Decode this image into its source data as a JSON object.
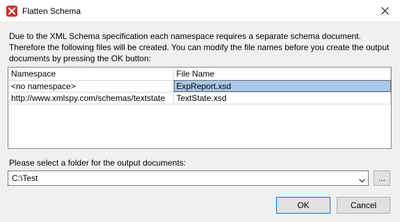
{
  "window": {
    "title": "Flatten Schema",
    "icon": "xmlspy-app-icon",
    "close_icon": "close-icon"
  },
  "description": {
    "line1": "Due to the XML Schema specification each namespace requires a separate schema document.",
    "line2": "Therefore the following files will be created. You can modify the file names before you create the output",
    "line3": "documents by pressing the OK button:"
  },
  "table": {
    "headers": [
      "Namespace",
      "File Name"
    ],
    "rows": [
      {
        "namespace": "<no namespace>",
        "file_name": "ExpReport.xsd",
        "selected": true
      },
      {
        "namespace": "http://www.xmlspy.com/schemas/textstate",
        "file_name": "TextState.xsd",
        "selected": false
      }
    ]
  },
  "folder": {
    "label": "Please select a folder for the output documents:",
    "value": "C:\\Test",
    "browse_label": "..."
  },
  "buttons": {
    "ok": "OK",
    "cancel": "Cancel"
  },
  "colors": {
    "selection": "#a9c8ea",
    "default_button_border": "#0078d7",
    "app_icon": "#d32f2f"
  }
}
